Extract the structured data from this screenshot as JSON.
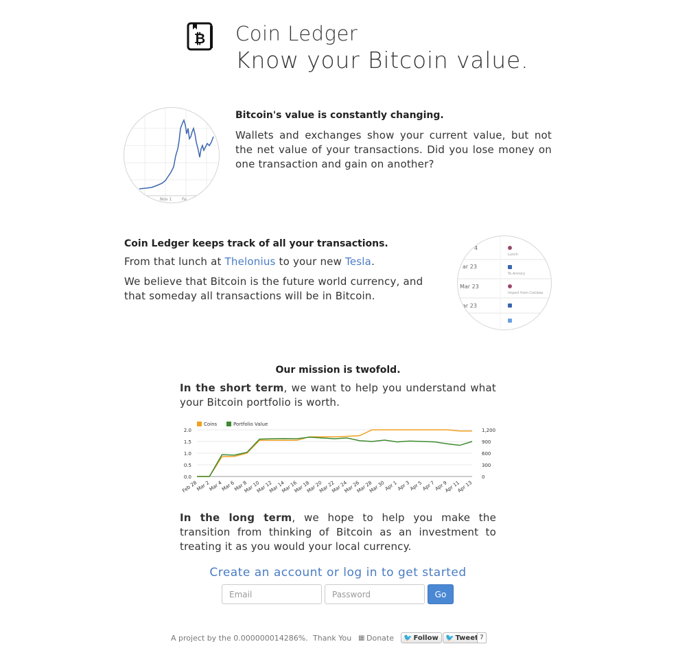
{
  "header": {
    "app_name": "Coin Ledger",
    "tagline": "Know your Bitcoin value."
  },
  "section_value": {
    "title": "Bitcoin's value is constantly changing.",
    "text": "Wallets and exchanges show your current value, but not the net value of your transactions. Did you lose money on one transaction and gain on another?",
    "thumb_x_labels": [
      "Nov 1",
      "Fe"
    ]
  },
  "section_track": {
    "title": "Coin Ledger keeps track of all your transactions.",
    "line1_prefix": "From that lunch at ",
    "link1": "Thelonius",
    "line1_middle": " to your new ",
    "link2": "Tesla",
    "line1_suffix": ".",
    "text2": "We believe that Bitcoin is the future world currency, and that someday all transactions will be in Bitcoin.",
    "thumb_rows": [
      {
        "date": "4",
        "label": "Lunch"
      },
      {
        "date": "ar 23",
        "label": "To Armory"
      },
      {
        "date": "Mar 23",
        "label": "Import from Coinbas"
      },
      {
        "date": "ar 23",
        "label": ""
      },
      {
        "date": "",
        "label": ""
      }
    ]
  },
  "mission": {
    "title": "Our mission is twofold.",
    "short_bold": "In the short term",
    "short_text": ", we want to help you understand what your Bitcoin portfolio is worth.",
    "long_bold": "In the long term",
    "long_text": ", we hope to help you make the transition from thinking of Bitcoin as an investment to treating it as you would your local currency."
  },
  "chart_data": {
    "type": "line",
    "title": "",
    "x": [
      "Feb 28",
      "Mar 2",
      "Mar 4",
      "Mar 6",
      "Mar 8",
      "Mar 10",
      "Mar 12",
      "Mar 14",
      "Mar 16",
      "Mar 18",
      "Mar 20",
      "Mar 22",
      "Mar 24",
      "Mar 26",
      "Mar 28",
      "Mar 30",
      "Apr 1",
      "Apr 3",
      "Apr 5",
      "Apr 7",
      "Apr 9",
      "Apr 11",
      "Apr 13"
    ],
    "series": [
      {
        "name": "Coins",
        "color": "#f0a020",
        "axis": "left",
        "values": [
          0.0,
          0.0,
          0.85,
          0.86,
          1.0,
          1.55,
          1.55,
          1.55,
          1.55,
          1.7,
          1.7,
          1.7,
          1.72,
          1.75,
          2.0,
          2.0,
          2.0,
          2.0,
          2.0,
          2.0,
          2.0,
          1.95,
          1.95
        ]
      },
      {
        "name": "Portfolio Value",
        "color": "#3c8a2e",
        "axis": "right",
        "values": [
          0,
          0,
          560,
          550,
          620,
          960,
          970,
          975,
          970,
          1010,
          990,
          970,
          990,
          920,
          900,
          935,
          890,
          910,
          900,
          890,
          840,
          800,
          900
        ]
      }
    ],
    "ylim_left": [
      0,
      2.0
    ],
    "yticks_left": [
      "0.0",
      "0.5",
      "1.0",
      "1.5",
      "2.0"
    ],
    "ylim_right": [
      0,
      1200
    ],
    "yticks_right": [
      "0",
      "300",
      "600",
      "900",
      "1,200"
    ],
    "grid": true,
    "legend": "top-left"
  },
  "cta": {
    "text": "Create an account or log in to get started"
  },
  "form": {
    "email_placeholder": "Email",
    "password_placeholder": "Password",
    "go_label": "Go"
  },
  "footer": {
    "project_text": "A project by the 0.000000014286%.",
    "thanks": "Thank You",
    "donate": "Donate",
    "follow": "Follow",
    "tweet": "Tweet",
    "tweet_count": "7"
  },
  "colors": {
    "accent": "#4a7cc4",
    "coins": "#f0a020",
    "portfolio": "#3c8a2e"
  }
}
